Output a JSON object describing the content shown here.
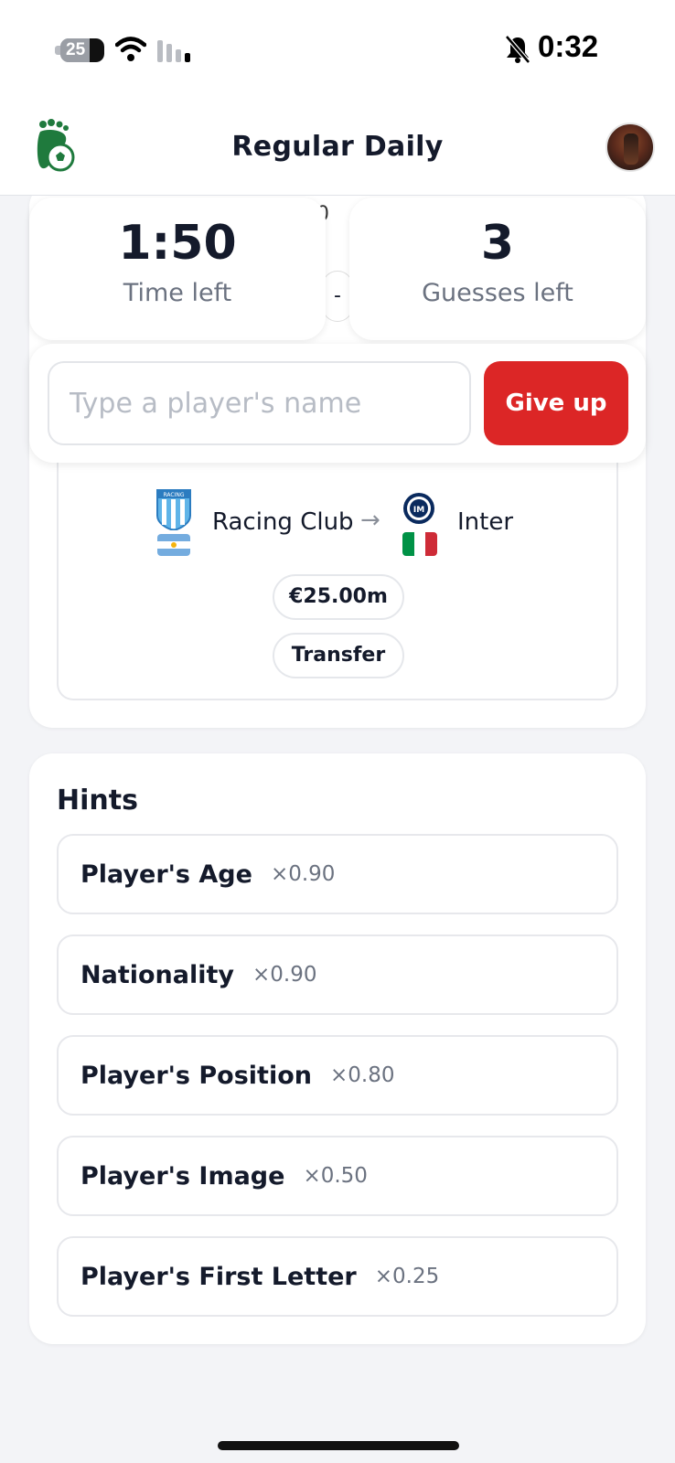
{
  "status_bar": {
    "battery_level": "25",
    "time": "0:32"
  },
  "header": {
    "title": "Regular Daily"
  },
  "background_peek": {
    "char": "0",
    "pill": "-"
  },
  "stats": {
    "time_left_value": "1:50",
    "time_left_label": "Time left",
    "guesses_left_value": "3",
    "guesses_left_label": "Guesses left"
  },
  "guess": {
    "placeholder": "Type a player's name",
    "give_up_label": "Give up"
  },
  "transfer": {
    "from_club": "Racing Club",
    "from_crest_text": "RACING",
    "arrow": "→",
    "to_club": "Inter",
    "fee": "€25.00m",
    "type": "Transfer"
  },
  "hints": {
    "title": "Hints",
    "items": [
      {
        "label": "Player's Age",
        "multiplier": "×0.90"
      },
      {
        "label": "Nationality",
        "multiplier": "×0.90"
      },
      {
        "label": "Player's Position",
        "multiplier": "×0.80"
      },
      {
        "label": "Player's Image",
        "multiplier": "×0.50"
      },
      {
        "label": "Player's First Letter",
        "multiplier": "×0.25"
      }
    ]
  },
  "colors": {
    "accent_red": "#dc2626",
    "logo_green": "#1f7a3d",
    "text_dark": "#141a2b",
    "text_muted": "#6b7280",
    "background": "#f3f4f7"
  },
  "icons": [
    "battery-icon",
    "wifi-icon",
    "signal-icon",
    "bell-muted-icon",
    "app-logo-icon",
    "racing-club-crest-icon",
    "argentina-flag-icon",
    "inter-crest-icon",
    "italy-flag-icon"
  ]
}
